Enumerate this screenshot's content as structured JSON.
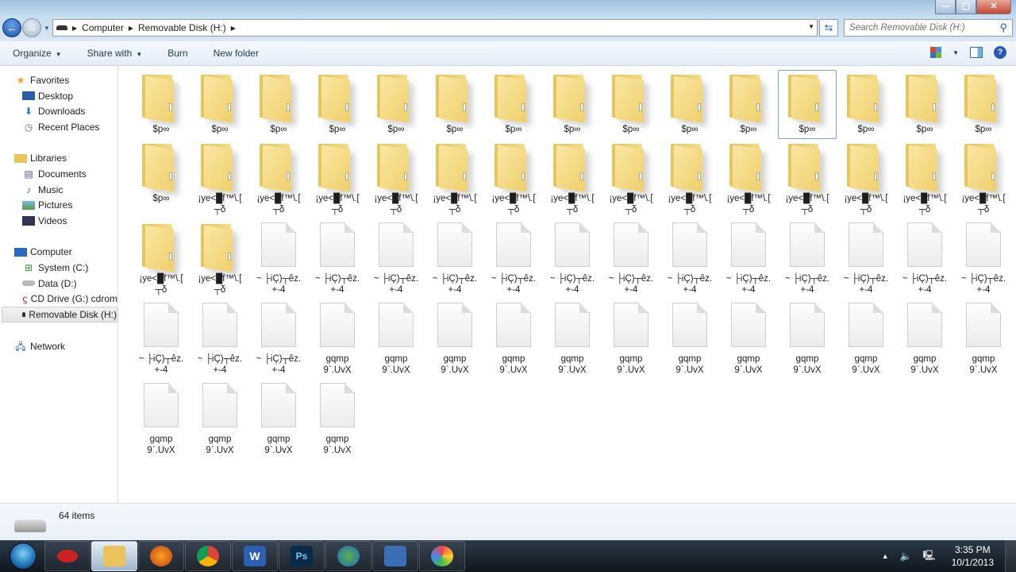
{
  "window": {
    "search_placeholder": "Search Removable Disk (H:)",
    "breadcrumb": [
      "Computer",
      "Removable Disk (H:)"
    ]
  },
  "toolbar": {
    "organize": "Organize",
    "share_with": "Share with",
    "burn": "Burn",
    "new_folder": "New folder",
    "help": "?"
  },
  "sidebar": {
    "favorites": {
      "label": "Favorites",
      "items": [
        "Desktop",
        "Downloads",
        "Recent Places"
      ]
    },
    "libraries": {
      "label": "Libraries",
      "items": [
        "Documents",
        "Music",
        "Pictures",
        "Videos"
      ]
    },
    "computer": {
      "label": "Computer",
      "items": [
        "System (C:)",
        "Data (D:)",
        "CD Drive (G:) cdrom",
        "Removable Disk (H:)"
      ],
      "selected": "Removable Disk (H:)"
    },
    "network": {
      "label": "Network"
    }
  },
  "files": {
    "groups": [
      {
        "type": "folder",
        "name": "$p∞",
        "count": 16
      },
      {
        "type": "folder",
        "name": "¡ye<█f™\\.[\n┬δ",
        "count": 16
      },
      {
        "type": "file",
        "name": "~ ├iÇ)┬êz.\n+-4",
        "count": 16
      },
      {
        "type": "file",
        "name": "gqmp\n9`.UvX",
        "count": 16
      }
    ],
    "selected_index": 11
  },
  "status": {
    "count": "64 items"
  },
  "taskbar": {
    "apps": [
      "app-red",
      "windows-explorer",
      "firefox",
      "chrome",
      "word",
      "photoshop",
      "download-manager",
      "app-blue",
      "paint"
    ],
    "active": "windows-explorer",
    "time": "3:35 PM",
    "date": "10/1/2013"
  }
}
